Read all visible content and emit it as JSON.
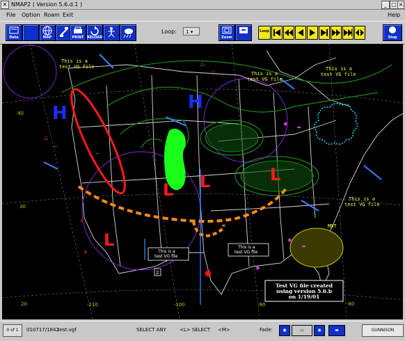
{
  "window": {
    "title": "NMAP2 ( Version 5.6.d.1 )"
  },
  "menu": {
    "file": "File",
    "option": "Option",
    "roam": "Roam",
    "exit": "Exit",
    "help": "Help"
  },
  "toolbar": {
    "data_label": "Data",
    "map_label": "MAP",
    "print_label": "PRINT",
    "reload_label": "RELOAD",
    "loop_label": "Loop:",
    "loop_value": "1",
    "zoom_label": "Zoom",
    "loop_btn_label": "Loop",
    "stop_label": "Stop"
  },
  "map": {
    "high_symbol": "H",
    "low_symbol": "L",
    "vg_note": "This is a test VG file",
    "vg_note_line1": "This is a",
    "vg_note_line2": "test VG file",
    "box_number": "2",
    "created_line1": "Test VG file created",
    "created_line2": "using version 5.6.b",
    "created_line3": "on 1/19/01",
    "mdt_label": "MDT",
    "lat_labels": [
      "40",
      "30",
      "20"
    ],
    "lon_labels": [
      "-110",
      "-100",
      "-90",
      "-80"
    ],
    "colors": {
      "high": "#1430ff",
      "low": "#ff1a1a",
      "front": "#ff8c1a",
      "notes": "#ffff40",
      "contour": "#1a8c1a"
    }
  },
  "status": {
    "frame_counter": "0 of 1",
    "datetime": "010717/1842",
    "file": "test.vgf",
    "mode": "SELECT ANY",
    "hint_left": "<L> SELECT",
    "hint_mid": "<M>",
    "fade_label": "Fade:",
    "site": "GUNNISON"
  }
}
